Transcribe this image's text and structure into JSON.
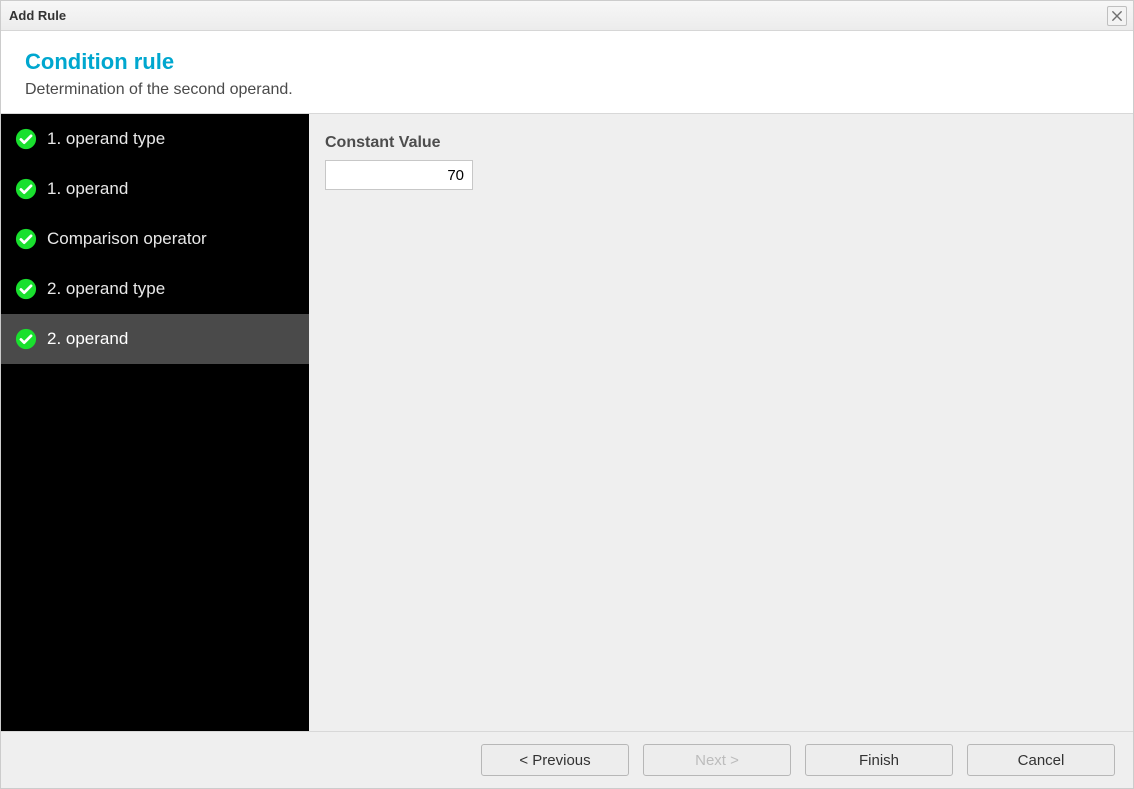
{
  "window": {
    "title": "Add Rule"
  },
  "header": {
    "title": "Condition rule",
    "subtitle": "Determination of the second operand."
  },
  "sidebar": {
    "items": [
      {
        "label": "1. operand type",
        "completed": true,
        "active": false
      },
      {
        "label": "1. operand",
        "completed": true,
        "active": false
      },
      {
        "label": "Comparison operator",
        "completed": true,
        "active": false
      },
      {
        "label": "2. operand type",
        "completed": true,
        "active": false
      },
      {
        "label": "2. operand",
        "completed": true,
        "active": true
      }
    ]
  },
  "content": {
    "constant_value_label": "Constant Value",
    "constant_value": "70"
  },
  "footer": {
    "previous_label": "< Previous",
    "next_label": "Next >",
    "finish_label": "Finish",
    "cancel_label": "Cancel",
    "next_enabled": false
  }
}
